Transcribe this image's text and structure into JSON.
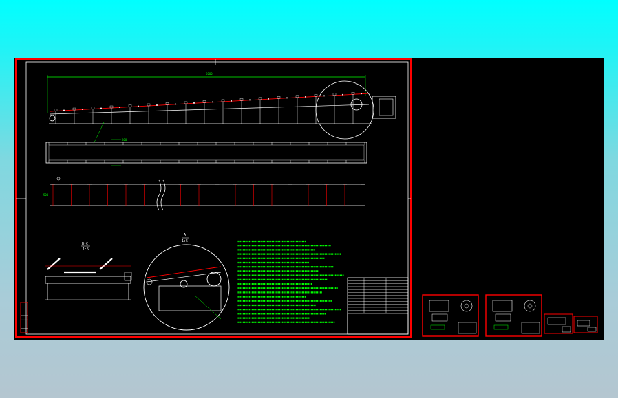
{
  "colors": {
    "background_top": "#00ffff",
    "background_bottom": "#b4c6d0",
    "canvas": "#000000",
    "frame": "#ff0000",
    "line": "#ffffff",
    "dimension": "#00ff00",
    "accent": "#ff0000"
  },
  "drawing": {
    "section_mark_bc": "B-C",
    "section_scale_bc": "1:5",
    "detail_mark_a": "A",
    "detail_scale_a": "1:5",
    "dim_label_top": "5000",
    "dim_label_mid": "800",
    "dim_label_bot": "500"
  },
  "notes": {
    "line_count": 20
  },
  "title_block": {
    "rows": 12
  },
  "thumbnails": [
    {
      "name": "sheet-1"
    },
    {
      "name": "sheet-2"
    },
    {
      "name": "sheet-3"
    },
    {
      "name": "sheet-4"
    }
  ]
}
